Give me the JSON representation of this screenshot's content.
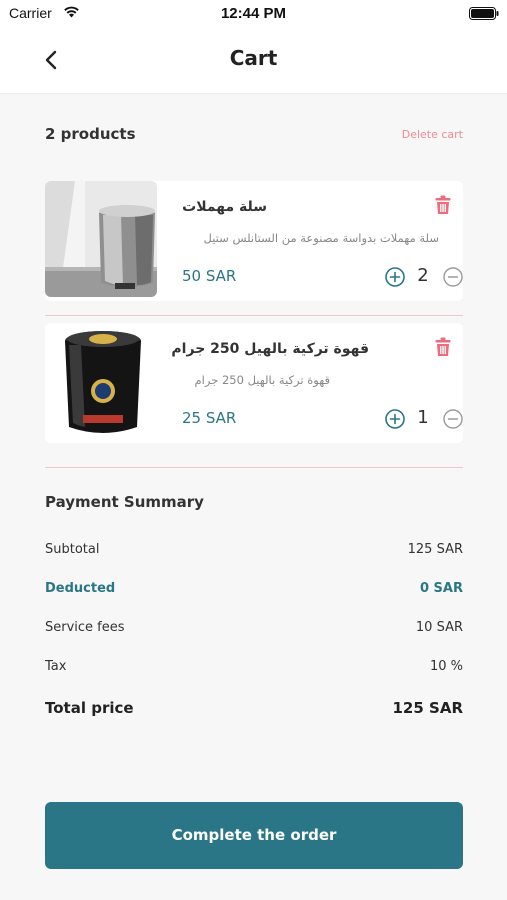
{
  "status_bar": {
    "carrier": "Carrier",
    "time": "12:44 PM"
  },
  "header": {
    "title": "Cart"
  },
  "products": {
    "count_label": "2 products",
    "delete_label": "Delete cart"
  },
  "items": [
    {
      "name": "سلة مهملات",
      "description": "سلة مهملات بدواسة مصنوعة من الستانلس ستيل",
      "price": "50 SAR",
      "quantity": "2"
    },
    {
      "name": "قهوة تركية بالهيل 250 جرام",
      "description": "قهوة تركية بالهيل 250 جرام",
      "price": "25 SAR",
      "quantity": "1"
    }
  ],
  "summary": {
    "title": "Payment Summary",
    "subtotal_label": "Subtotal",
    "subtotal_value": "125 SAR",
    "deducted_label": "Deducted",
    "deducted_value": "0 SAR",
    "service_label": "Service fees",
    "service_value": "10 SAR",
    "tax_label": "Tax",
    "tax_value": "10 %",
    "total_label": "Total price",
    "total_value": "125 SAR"
  },
  "cta": {
    "label": "Complete the order"
  },
  "colors": {
    "accent": "#2a7686",
    "danger": "#ef6a7a"
  }
}
